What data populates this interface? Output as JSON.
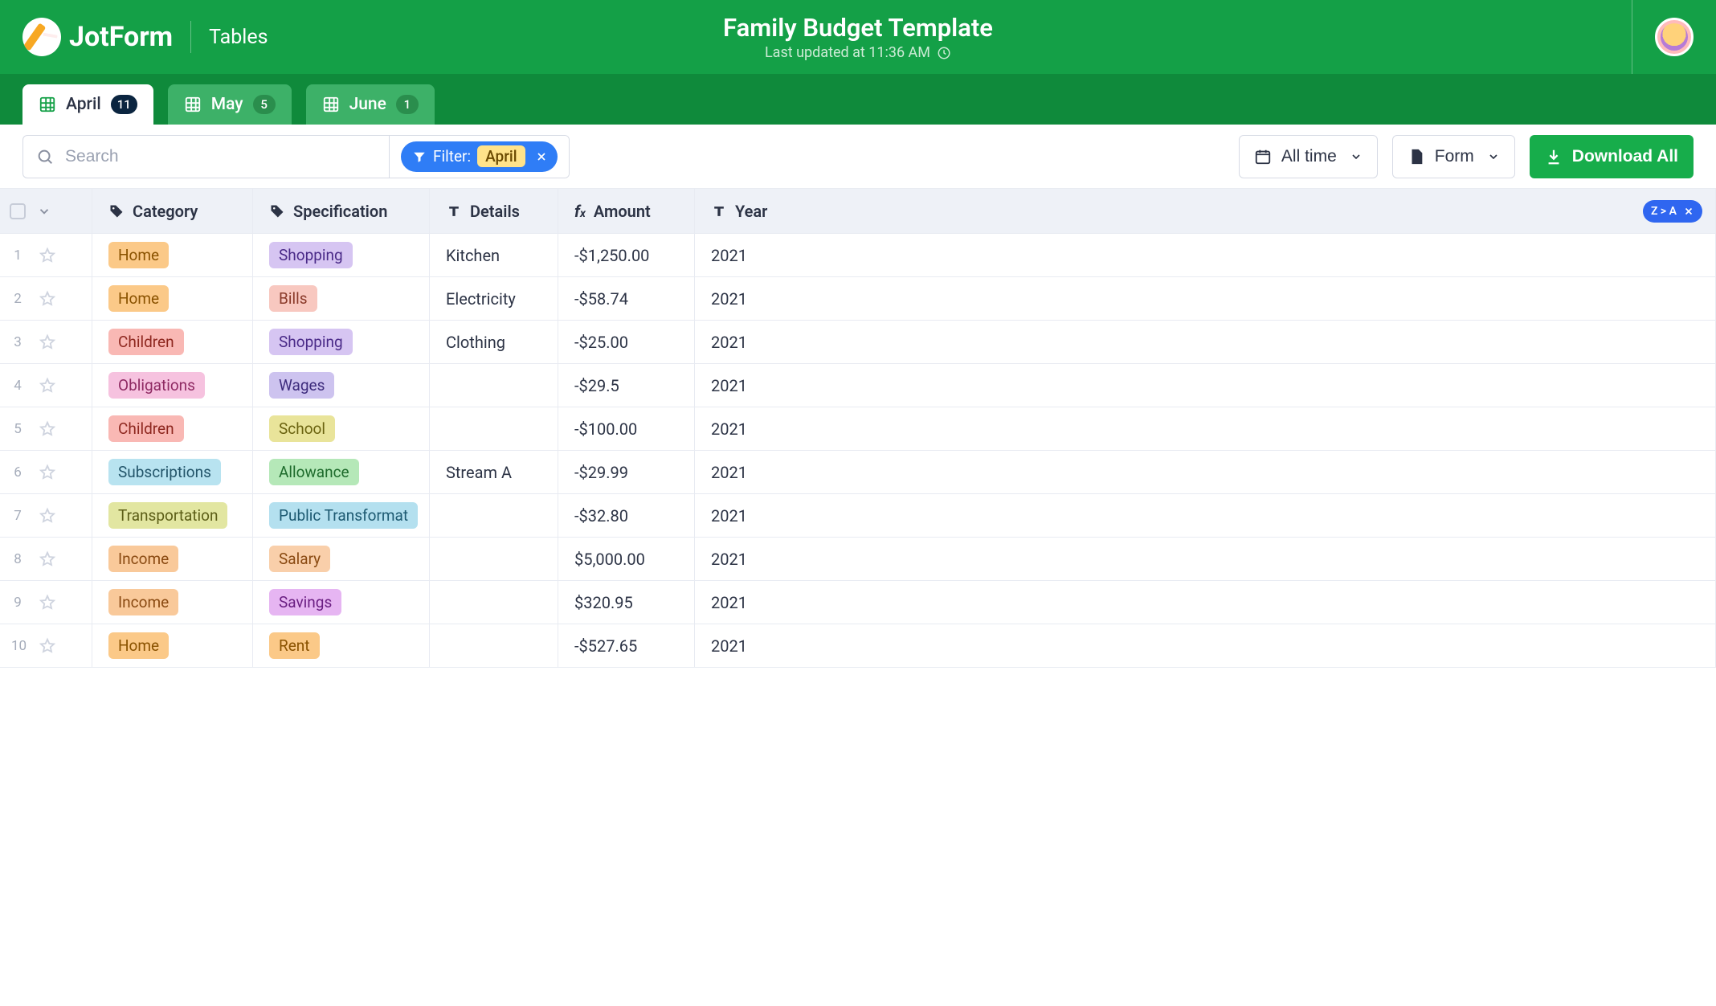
{
  "header": {
    "brand": "JotForm",
    "appSub": "Tables",
    "title": "Family Budget Template",
    "lastUpdated": "Last updated at 11:36 AM"
  },
  "tabs": [
    {
      "label": "April",
      "count": "11",
      "active": true
    },
    {
      "label": "May",
      "count": "5",
      "active": false
    },
    {
      "label": "June",
      "count": "1",
      "active": false
    }
  ],
  "toolbar": {
    "searchPlaceholder": "Search",
    "filterLabel": "Filter:",
    "filterValue": "April",
    "dateRange": "All time",
    "formLabel": "Form",
    "downloadLabel": "Download All"
  },
  "columns": {
    "category": "Category",
    "specification": "Specification",
    "details": "Details",
    "amount": "Amount",
    "year": "Year"
  },
  "sortBadge": "Z > A",
  "rows": [
    {
      "n": "1",
      "category": {
        "text": "Home",
        "cls": "home"
      },
      "spec": {
        "text": "Shopping",
        "cls": "shopping"
      },
      "details": "Kitchen",
      "amount": "-$1,250.00",
      "year": "2021"
    },
    {
      "n": "2",
      "category": {
        "text": "Home",
        "cls": "home"
      },
      "spec": {
        "text": "Bills",
        "cls": "bills"
      },
      "details": "Electricity",
      "amount": "-$58.74",
      "year": "2021"
    },
    {
      "n": "3",
      "category": {
        "text": "Children",
        "cls": "children"
      },
      "spec": {
        "text": "Shopping",
        "cls": "shopping"
      },
      "details": "Clothing",
      "amount": "-$25.00",
      "year": "2021"
    },
    {
      "n": "4",
      "category": {
        "text": "Obligations",
        "cls": "obligations"
      },
      "spec": {
        "text": "Wages",
        "cls": "wages"
      },
      "details": "",
      "amount": "-$29.5",
      "year": "2021"
    },
    {
      "n": "5",
      "category": {
        "text": "Children",
        "cls": "children"
      },
      "spec": {
        "text": "School",
        "cls": "school"
      },
      "details": "",
      "amount": "-$100.00",
      "year": "2021"
    },
    {
      "n": "6",
      "category": {
        "text": "Subscriptions",
        "cls": "subscriptions"
      },
      "spec": {
        "text": "Allowance",
        "cls": "allowance"
      },
      "details": "Stream A",
      "amount": "-$29.99",
      "year": "2021"
    },
    {
      "n": "7",
      "category": {
        "text": "Transportation",
        "cls": "transportation"
      },
      "spec": {
        "text": "Public Transformat",
        "cls": "public"
      },
      "details": "",
      "amount": "-$32.80",
      "year": "2021"
    },
    {
      "n": "8",
      "category": {
        "text": "Income",
        "cls": "income"
      },
      "spec": {
        "text": "Salary",
        "cls": "salary"
      },
      "details": "",
      "amount": "$5,000.00",
      "year": "2021"
    },
    {
      "n": "9",
      "category": {
        "text": "Income",
        "cls": "income"
      },
      "spec": {
        "text": "Savings",
        "cls": "savings"
      },
      "details": "",
      "amount": "$320.95",
      "year": "2021"
    },
    {
      "n": "10",
      "category": {
        "text": "Home",
        "cls": "home"
      },
      "spec": {
        "text": "Rent",
        "cls": "rent"
      },
      "details": "",
      "amount": "-$527.65",
      "year": "2021"
    }
  ]
}
